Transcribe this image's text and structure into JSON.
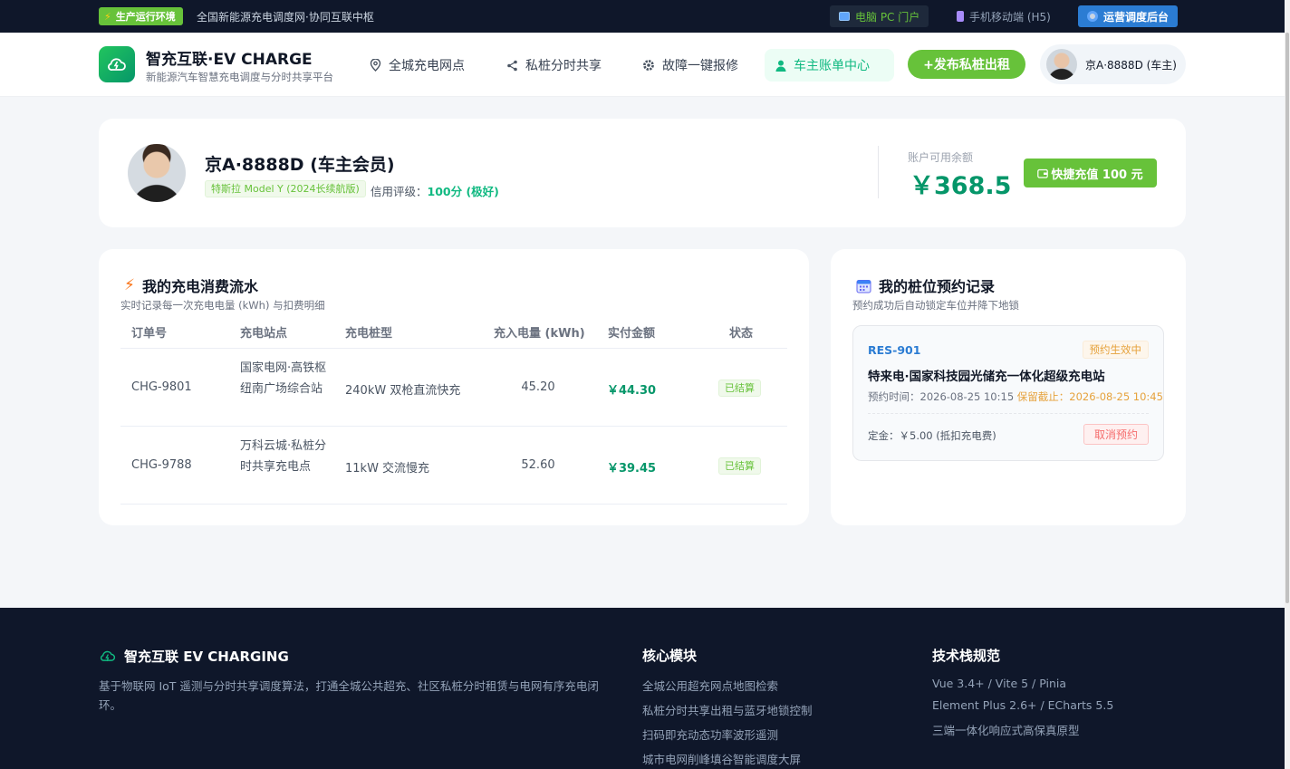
{
  "topbar": {
    "env_label": "生产运行环境",
    "slogan": "全国新能源充电调度网·协同互联中枢",
    "pc_portal": "电脑 PC 门户",
    "h5": "手机移动端 (H5)",
    "ops": "运营调度后台"
  },
  "header": {
    "brand_name": "智充互联·EV CHARGE",
    "brand_sub": "新能源汽车智慧充电调度与分时共享平台",
    "nav": {
      "map": "全城充电网点",
      "share": "私桩分时共享",
      "repair": "故障一键报修",
      "bill": "车主账单中心"
    },
    "publish": "+发布私桩出租",
    "user": "京A·8888D (车主)"
  },
  "profile": {
    "name": "京A·8888D (车主会员)",
    "car": "特斯拉 Model Y (2024长续航版)",
    "credit_label": "信用评级：",
    "credit_value": "100分 (极好)",
    "balance_label": "账户可用余额",
    "balance": "￥368.5",
    "recharge": "快捷充值 100 元"
  },
  "flow": {
    "title": "我的充电消费流水",
    "subtitle": "实时记录每一次充电电量 (kWh) 与扣费明细",
    "headers": [
      "订单号",
      "充电站点",
      "充电桩型",
      "充入电量 (kWh)",
      "实付金额",
      "状态"
    ],
    "rows": [
      {
        "order": "CHG-9801",
        "site": "国家电网·高铁枢纽南广场综合站",
        "type": "240kW 双枪直流快充",
        "kwh": "45.20",
        "amount": "￥44.30",
        "status": "已结算"
      },
      {
        "order": "CHG-9788",
        "site": "万科云城·私桩分时共享充电点",
        "type": "11kW 交流慢充",
        "kwh": "52.60",
        "amount": "￥39.45",
        "status": "已结算"
      }
    ]
  },
  "reservation": {
    "title": "我的桩位预约记录",
    "subtitle": "预约成功后自动锁定车位并降下地锁",
    "id": "RES-901",
    "tag": "预约生效中",
    "station": "特来电·国家科技园光储充一体化超级充电站",
    "time_label": "预约时间：",
    "time": "2026-08-25 10:15",
    "hold_label": "保留截止：",
    "hold": "2026-08-25 10:45",
    "fee": "定金：￥5.00 (抵扣充电费)",
    "cancel": "取消预约"
  },
  "footer": {
    "brand": "智充互联 EV CHARGING",
    "desc": "基于物联网 IoT 遥测与分时共享调度算法，打通全城公共超充、社区私桩分时租赁与电网有序充电闭环。",
    "col1_title": "核心模块",
    "col1": [
      "全城公用超充网点地图检索",
      "私桩分时共享出租与蓝牙地锁控制",
      "扫码即充动态功率波形遥测",
      "城市电网削峰填谷智能调度大屏"
    ],
    "col2_title": "技术栈规范",
    "col2": [
      "Vue 3.4+ / Vite 5 / Pinia",
      "Element Plus 2.6+ / ECharts 5.5",
      "三端一体化响应式高保真原型"
    ]
  },
  "colors": {
    "brand_green": "#67c23a",
    "accent_teal": "#10b981",
    "money_green": "#059669",
    "nav_dark": "#0f172a",
    "ops_blue": "#2b7cd3"
  },
  "icons": [
    "bolt-icon",
    "monitor-icon",
    "phone-icon",
    "gear-icon",
    "cloud-bolt-icon",
    "location-icon",
    "share-icon",
    "settings-icon",
    "user-icon",
    "wallet-icon",
    "calendar-icon"
  ]
}
